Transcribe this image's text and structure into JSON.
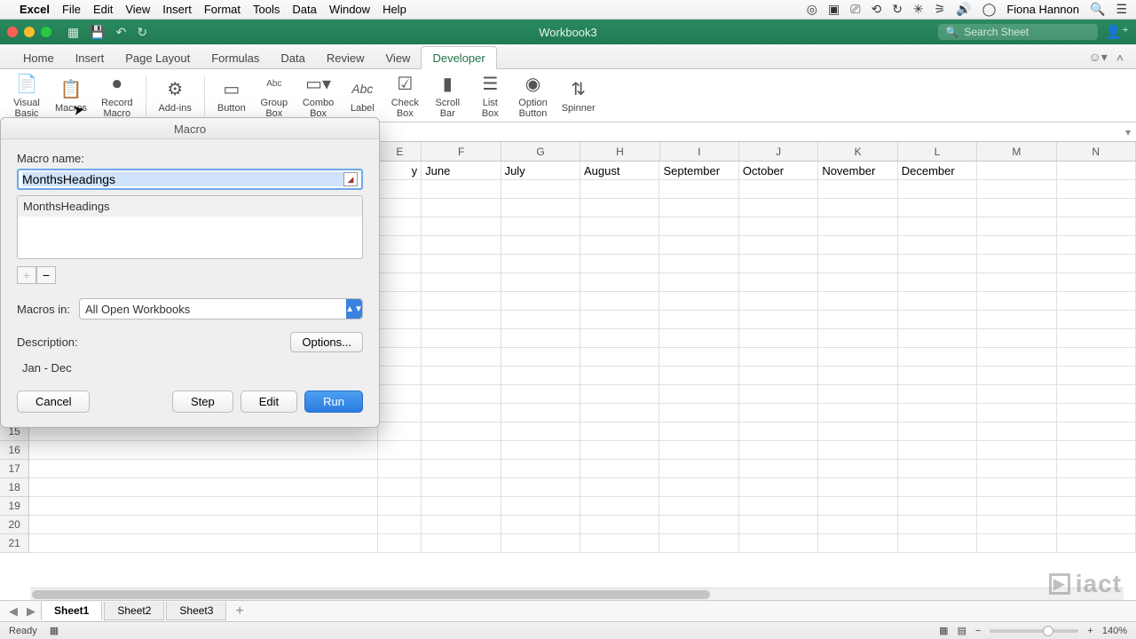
{
  "menubar": {
    "app": "Excel",
    "items": [
      "File",
      "Edit",
      "View",
      "Insert",
      "Format",
      "Tools",
      "Data",
      "Window",
      "Help"
    ],
    "user": "Fiona Hannon"
  },
  "titlebar": {
    "document": "Workbook3",
    "search_placeholder": "Search Sheet"
  },
  "ribbon": {
    "tabs": [
      "Home",
      "Insert",
      "Page Layout",
      "Formulas",
      "Data",
      "Review",
      "View",
      "Developer"
    ],
    "active_tab": "Developer",
    "buttons": {
      "visual_basic": "Visual\nBasic",
      "macros": "Macros",
      "record_macro": "Record\nMacro",
      "addins": "Add-ins",
      "button": "Button",
      "group_box": "Group\nBox",
      "combo_box": "Combo\nBox",
      "label": "Label",
      "check_box": "Check\nBox",
      "scroll_bar": "Scroll\nBar",
      "list_box": "List\nBox",
      "option_button": "Option\nButton",
      "spinner": "Spinner"
    }
  },
  "sheet": {
    "visible_columns": [
      "E",
      "F",
      "G",
      "H",
      "I",
      "J",
      "K",
      "L",
      "M",
      "N"
    ],
    "row1_values": {
      "E": "y",
      "F": "June",
      "G": "July",
      "H": "August",
      "I": "September",
      "J": "October",
      "K": "November",
      "L": "December"
    },
    "visible_row_start": 15,
    "visible_row_end": 21
  },
  "tabs": {
    "sheets": [
      "Sheet1",
      "Sheet2",
      "Sheet3"
    ],
    "active": "Sheet1"
  },
  "statusbar": {
    "status": "Ready",
    "zoom": "140%"
  },
  "dialog": {
    "title": "Macro",
    "name_label": "Macro name:",
    "name_value": "MonthsHeadings",
    "list": [
      "MonthsHeadings"
    ],
    "macros_in_label": "Macros in:",
    "macros_in_value": "All Open Workbooks",
    "description_label": "Description:",
    "options_label": "Options...",
    "description_text": "Jan - Dec",
    "buttons": {
      "cancel": "Cancel",
      "step": "Step",
      "edit": "Edit",
      "run": "Run"
    }
  },
  "watermark": "iact"
}
